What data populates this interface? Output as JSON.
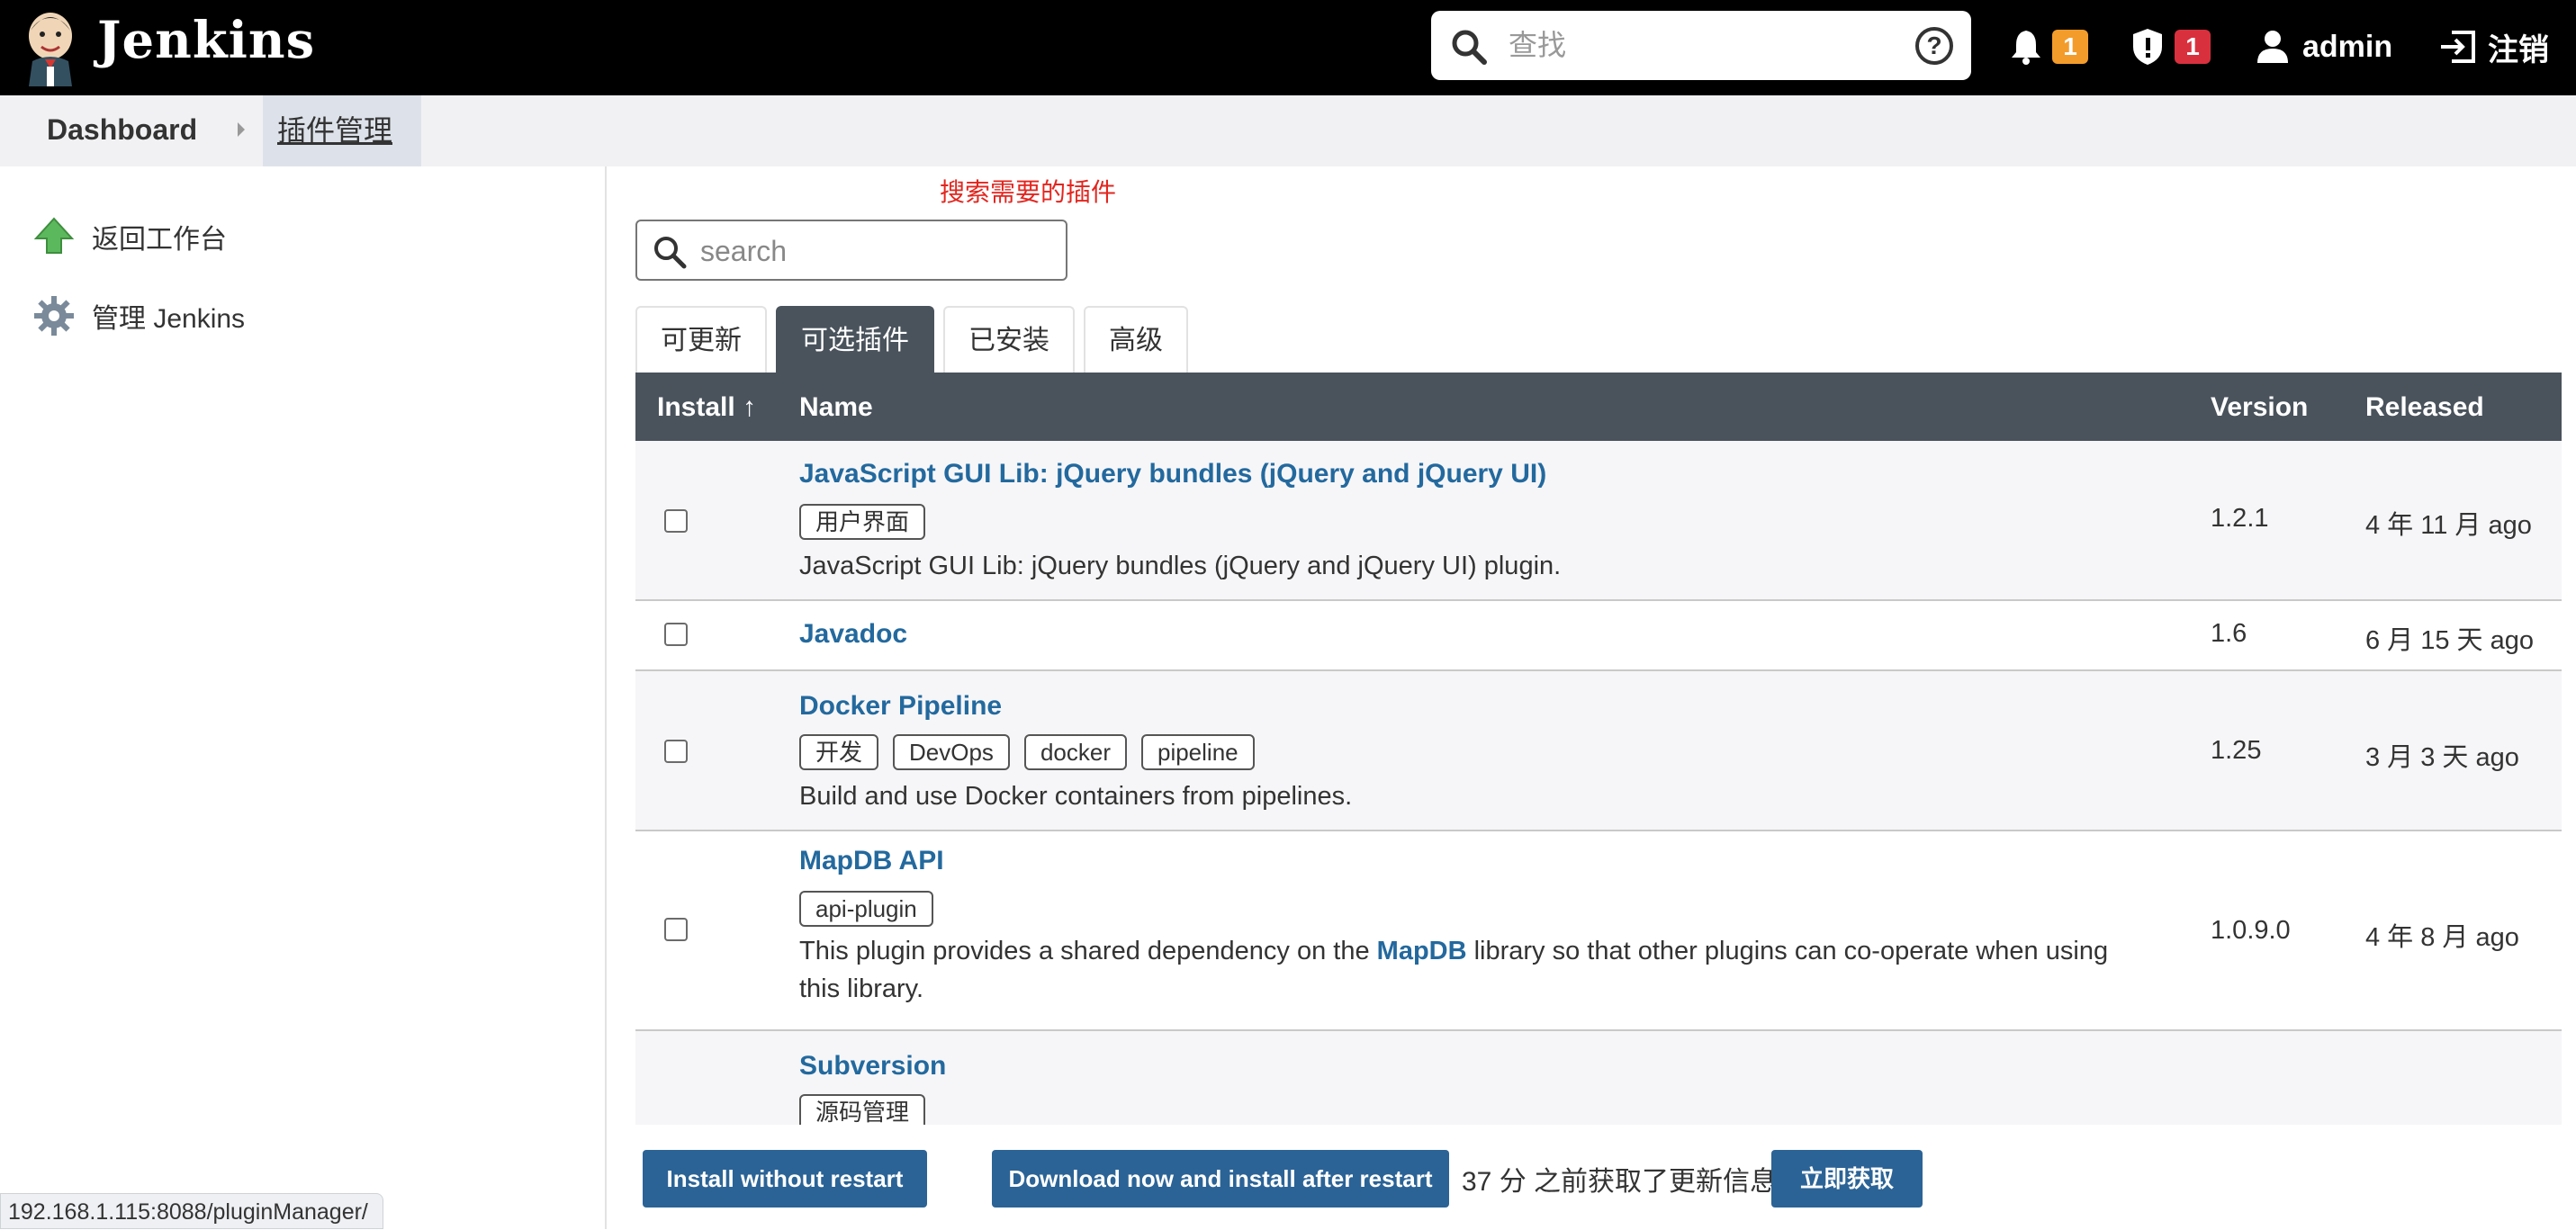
{
  "header": {
    "brand": "Jenkins",
    "search_placeholder": "查找",
    "notifications_count": "1",
    "security_count": "1",
    "user": "admin",
    "logout": "注销"
  },
  "breadcrumb": {
    "home": "Dashboard",
    "current": "插件管理"
  },
  "sidebar": {
    "items": [
      {
        "label": "返回工作台",
        "icon": "up-arrow-icon"
      },
      {
        "label": "管理 Jenkins",
        "icon": "gear-icon"
      }
    ]
  },
  "annotation": "搜索需要的插件",
  "filter": {
    "placeholder": "search"
  },
  "tabs": [
    {
      "label": "可更新"
    },
    {
      "label": "可选插件",
      "active": true
    },
    {
      "label": "已安装"
    },
    {
      "label": "高级"
    }
  ],
  "table": {
    "headers": {
      "install": "Install",
      "sort_arrow": "↑",
      "name": "Name",
      "version": "Version",
      "released": "Released"
    },
    "rows": [
      {
        "name": "JavaScript GUI Lib: jQuery bundles (jQuery and jQuery UI)",
        "labels": [
          "用户界面"
        ],
        "desc_parts": [
          "JavaScript GUI Lib: jQuery bundles (jQuery and jQuery UI) plugin."
        ],
        "version": "1.2.1",
        "released": "4 年 11 月 ago"
      },
      {
        "name": "Javadoc",
        "labels": [],
        "desc_parts": [],
        "version": "1.6",
        "released": "6 月 15 天 ago"
      },
      {
        "name": "Docker Pipeline",
        "labels": [
          "开发",
          "DevOps",
          "docker",
          "pipeline"
        ],
        "desc_parts": [
          "Build and use Docker containers from pipelines."
        ],
        "version": "1.25",
        "released": "3 月 3 天 ago"
      },
      {
        "name": "MapDB API",
        "labels": [
          "api-plugin"
        ],
        "desc_before": "This plugin provides a shared dependency on the ",
        "desc_link": "MapDB",
        "desc_after": " library so that other plugins can co-operate when using this library.",
        "version": "1.0.9.0",
        "released": "4 年 8 月 ago"
      },
      {
        "name": "Subversion",
        "labels": [
          "源码管理"
        ],
        "desc_parts": [],
        "version": "",
        "released": ""
      }
    ]
  },
  "bottom": {
    "install_btn": "Install without restart",
    "download_btn": "Download now and install after restart",
    "update_info": "37 分 之前获取了更新信息",
    "fetch_btn": "立即获取"
  },
  "status_url": "192.168.1.115:8088/pluginManager/",
  "colors": {
    "header_bg": "#000000",
    "link": "#23699e",
    "button": "#2b6396",
    "table_header": "#4a535c",
    "badge_warning": "#f39c2b",
    "badge_danger": "#d9303e",
    "annotation": "#e2261f"
  }
}
